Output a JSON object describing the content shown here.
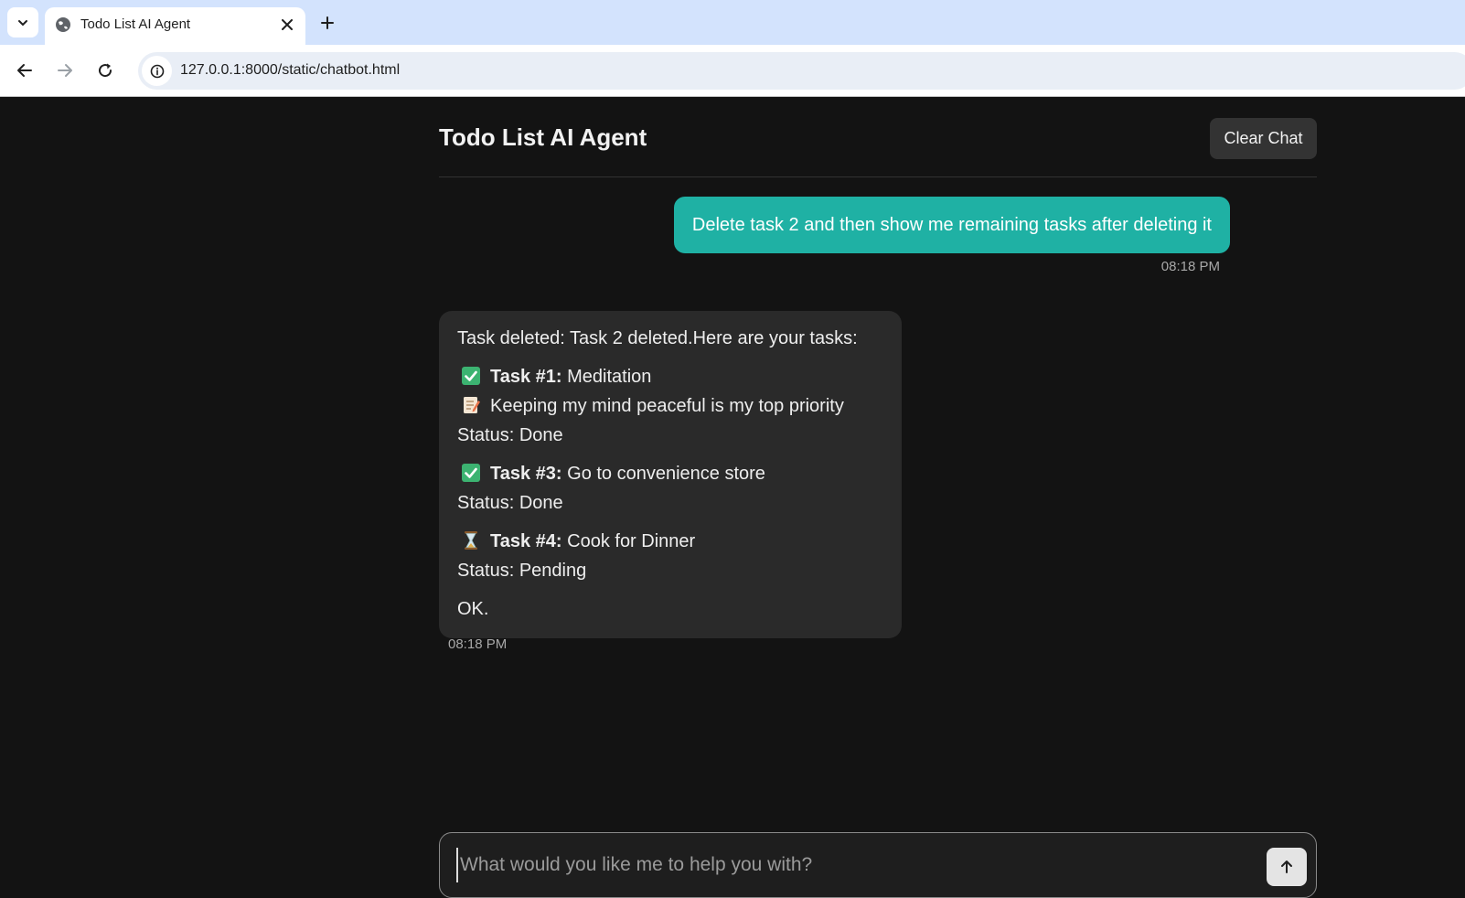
{
  "browser": {
    "tab_title": "Todo List AI Agent",
    "url": "127.0.0.1:8000/static/chatbot.html"
  },
  "app": {
    "title": "Todo List AI Agent",
    "clear_label": "Clear Chat"
  },
  "messages": {
    "user": {
      "text": "Delete task 2 and then show me remaining tasks after deleting it",
      "time": "08:18 PM"
    },
    "bot": {
      "intro": "Task deleted: Task 2 deleted.Here are your tasks:",
      "tasks": [
        {
          "icon": "check-mark-icon",
          "label": "Task #1:",
          "name": " Meditation",
          "note_icon": "memo-icon",
          "note": "Keeping my mind peaceful is my top priority",
          "status": "Status: Done"
        },
        {
          "icon": "check-mark-icon",
          "label": "Task #3:",
          "name": " Go to convenience store",
          "status": "Status: Done"
        },
        {
          "icon": "hourglass-icon",
          "label": "Task #4:",
          "name": " Cook for Dinner",
          "status": "Status: Pending"
        }
      ],
      "closing": "OK.",
      "time": "08:18 PM"
    }
  },
  "composer": {
    "placeholder": "What would you like me to help you with?",
    "value": ""
  },
  "colors": {
    "accent": "#1fb1a4",
    "background": "#131313",
    "bubble": "#2a2a2a",
    "done": "#3cb371"
  }
}
